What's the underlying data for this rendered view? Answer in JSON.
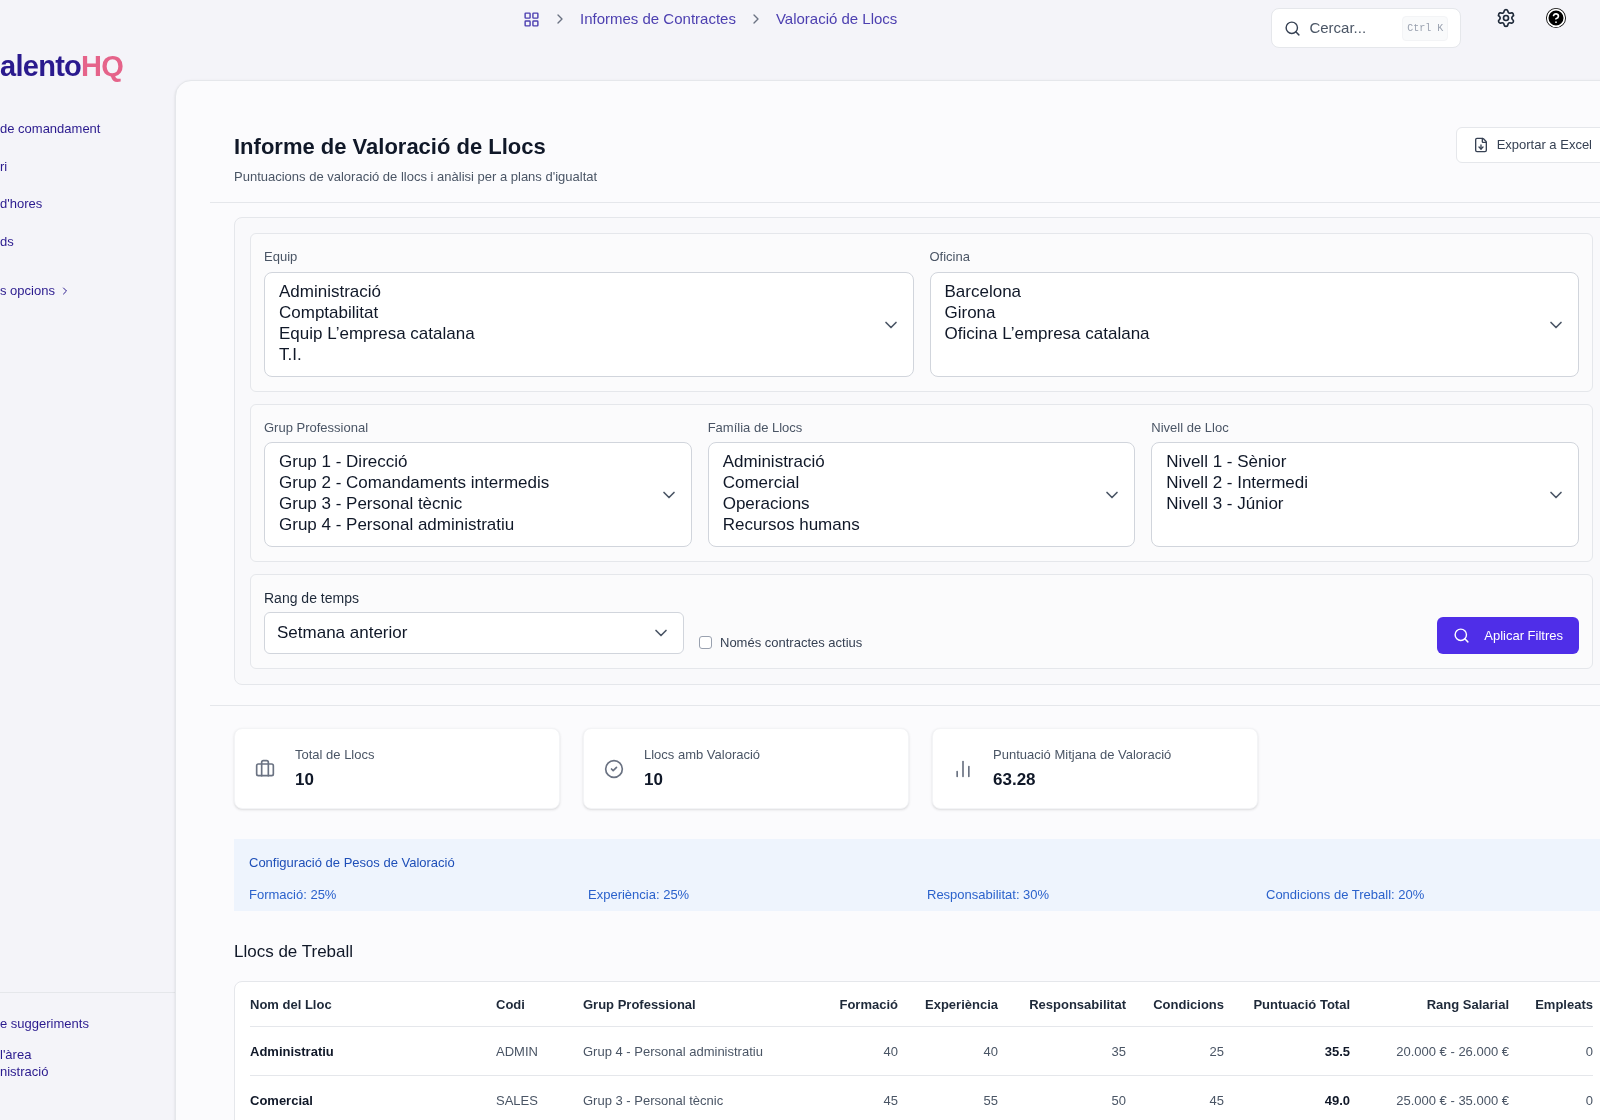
{
  "sidebar": {
    "logo": {
      "main": "alento",
      "accent": "HQ"
    },
    "items": [
      {
        "label": "de comandament",
        "has_chevron": false
      },
      {
        "label": "ri",
        "has_chevron": false
      },
      {
        "label": "d'hores",
        "has_chevron": false
      },
      {
        "label": "ds",
        "has_chevron": false
      },
      {
        "label": "s opcions",
        "has_chevron": true
      }
    ],
    "footer_items": [
      "e suggeriments",
      "l'àrea\nnistració"
    ]
  },
  "breadcrumb": [
    "Informes de Contractes",
    "Valoració de Llocs"
  ],
  "search": {
    "placeholder": "Cercar...",
    "shortcut": "Ctrl K"
  },
  "page": {
    "title": "Informe de Valoració de Llocs",
    "subtitle": "Puntuacions de valoració de llocs i anàlisi per a plans d'igualtat",
    "export_button": "Exportar a Excel"
  },
  "filters": {
    "rows": [
      [
        {
          "label": "Equip",
          "options": [
            "Administració",
            "Comptabilitat",
            "Equip L’empresa catalana",
            "T.I."
          ]
        },
        {
          "label": "Oficina",
          "options": [
            "Barcelona",
            "Girona",
            "Oficina L’empresa catalana"
          ]
        }
      ],
      [
        {
          "label": "Grup Professional",
          "options": [
            "Grup 1 - Direcció",
            "Grup 2 - Comandaments intermedis",
            "Grup 3 - Personal tècnic",
            "Grup 4 - Personal administratiu"
          ]
        },
        {
          "label": "Família de Llocs",
          "options": [
            "Administració",
            "Comercial",
            "Operacions",
            "Recursos humans"
          ]
        },
        {
          "label": "Nivell de Lloc",
          "options": [
            "Nivell 1 - Sènior",
            "Nivell 2 - Intermedi",
            "Nivell 3 - Júnior"
          ]
        }
      ]
    ],
    "time_range": {
      "label": "Rang de temps",
      "value": "Setmana anterior"
    },
    "active_only": {
      "label": "Només contractes actius",
      "checked": false
    },
    "apply_button": "Aplicar Filtres"
  },
  "stats": [
    {
      "kind": "briefcase",
      "label": "Total de Llocs",
      "value": "10"
    },
    {
      "kind": "check",
      "label": "Llocs amb Valoració",
      "value": "10"
    },
    {
      "kind": "chart",
      "label": "Puntuació Mitjana de Valoració",
      "value": "63.28"
    }
  ],
  "weights": {
    "title": "Configuració de Pesos de Valoració",
    "items": [
      "Formació: 25%",
      "Experiència: 25%",
      "Responsabilitat: 30%",
      "Condicions de Treball: 20%"
    ]
  },
  "table": {
    "title": "Llocs de Treball",
    "columns": [
      "Nom del Lloc",
      "Codi",
      "Grup Professional",
      "Formació",
      "Experiència",
      "Responsabilitat",
      "Condicions",
      "Puntuació Total",
      "Rang Salarial",
      "Empleats"
    ],
    "rows": [
      [
        "Administratiu",
        "ADMIN",
        "Grup 4 - Personal administratiu",
        "40",
        "40",
        "35",
        "25",
        "35.5",
        "20.000 € - 26.000 €",
        "0"
      ],
      [
        "Comercial",
        "SALES",
        "Grup 3 - Personal tècnic",
        "45",
        "55",
        "50",
        "45",
        "49.0",
        "25.000 € - 35.000 €",
        "0"
      ]
    ]
  }
}
